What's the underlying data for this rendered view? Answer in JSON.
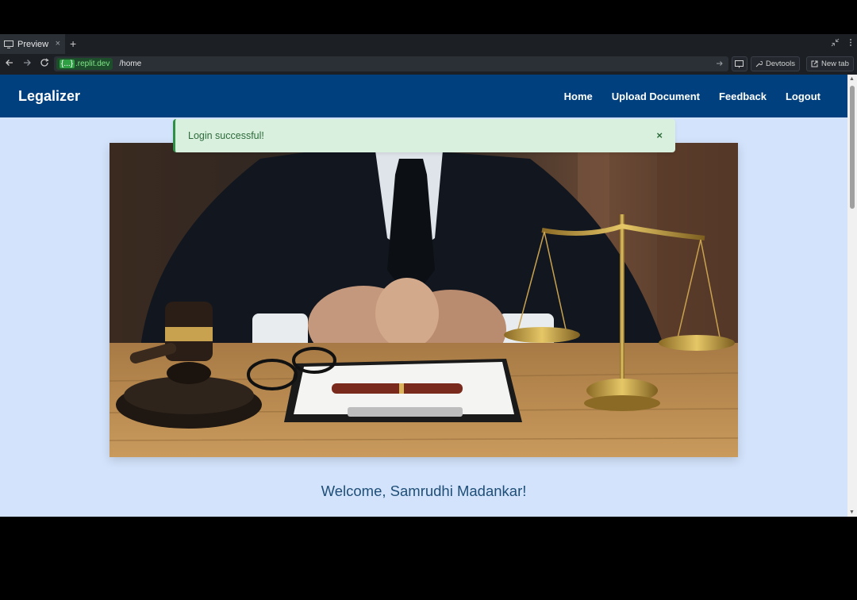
{
  "browser": {
    "tab_label": "Preview",
    "tab_close": "×",
    "new_tab_plus": "+",
    "host_prefix": "{...}",
    "host": ".replit.dev",
    "path": "/home",
    "devtools_label": "Devtools",
    "newtab_label": "New tab"
  },
  "app": {
    "brand": "Legalizer",
    "nav": [
      "Home",
      "Upload Document",
      "Feedback",
      "Logout"
    ]
  },
  "alert": {
    "message": "Login successful!",
    "close": "×"
  },
  "welcome": "Welcome, Samrudhi Madankar!",
  "colors": {
    "navbar": "#01407e",
    "page_bg": "#d3e3fb",
    "alert_bg": "#d9f0de",
    "alert_text": "#2d6b3a",
    "welcome_text": "#1e4e78"
  }
}
